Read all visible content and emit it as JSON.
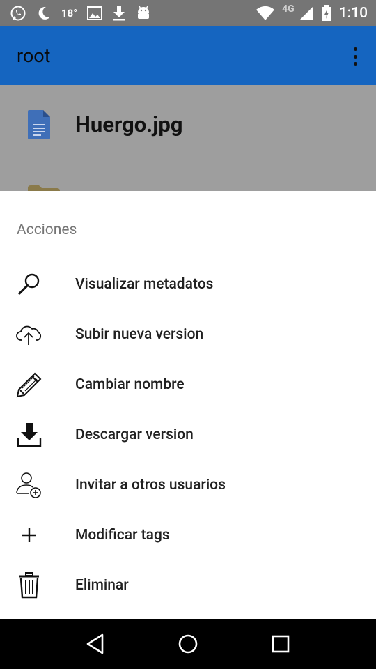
{
  "status_bar": {
    "temperature": "18°",
    "network": "4G",
    "time": "1:10",
    "icons": [
      "whatsapp-icon",
      "moon-icon",
      "image-icon",
      "download-icon",
      "android-icon",
      "wifi-icon",
      "signal-icon",
      "battery-icon"
    ]
  },
  "app_bar": {
    "title": "root",
    "menu_icon": "overflow-menu-icon"
  },
  "file_list": {
    "items": [
      {
        "name": "Huergo.jpg",
        "icon": "document-icon"
      },
      {
        "name": "",
        "icon": "folder-icon"
      }
    ]
  },
  "sheet": {
    "title": "Acciones",
    "actions": [
      {
        "label": "Visualizar metadatos",
        "icon": "magnifier-icon"
      },
      {
        "label": "Subir nueva version",
        "icon": "cloud-upload-icon"
      },
      {
        "label": "Cambiar nombre",
        "icon": "pencil-icon"
      },
      {
        "label": "Descargar version",
        "icon": "download-icon"
      },
      {
        "label": "Invitar a otros usuarios",
        "icon": "add-user-icon"
      },
      {
        "label": "Modificar tags",
        "icon": "plus-icon"
      },
      {
        "label": "Eliminar",
        "icon": "trash-icon"
      }
    ]
  },
  "nav_bar": {
    "buttons": [
      "back-icon",
      "home-icon",
      "recents-icon"
    ]
  },
  "colors": {
    "app_bar": "#1565c0",
    "status_bar": "#757575",
    "scrim": "#9e9e9e",
    "sheet": "#ffffff"
  }
}
